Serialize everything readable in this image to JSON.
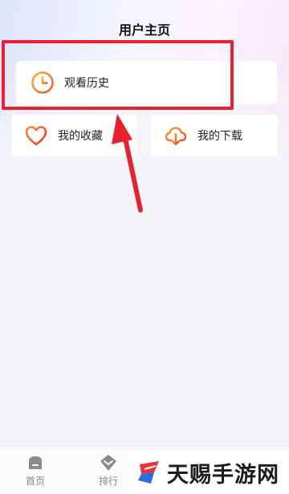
{
  "header": {
    "title": "用户主页"
  },
  "menu": {
    "history": {
      "label": "观看历史",
      "icon": "clock-icon"
    },
    "favorites": {
      "label": "我的收藏",
      "icon": "heart-icon"
    },
    "downloads": {
      "label": "我的下载",
      "icon": "cloud-download-icon"
    }
  },
  "tabbar": {
    "items": [
      {
        "label": "首页",
        "icon": "home-icon"
      },
      {
        "label": "排行",
        "icon": "rank-icon"
      }
    ]
  },
  "watermark": {
    "text": "天赐手游网"
  },
  "colors": {
    "accent_orange": "#f07a1c",
    "highlight_red": "#e8202f",
    "tab_gray": "#8a8a8e"
  }
}
